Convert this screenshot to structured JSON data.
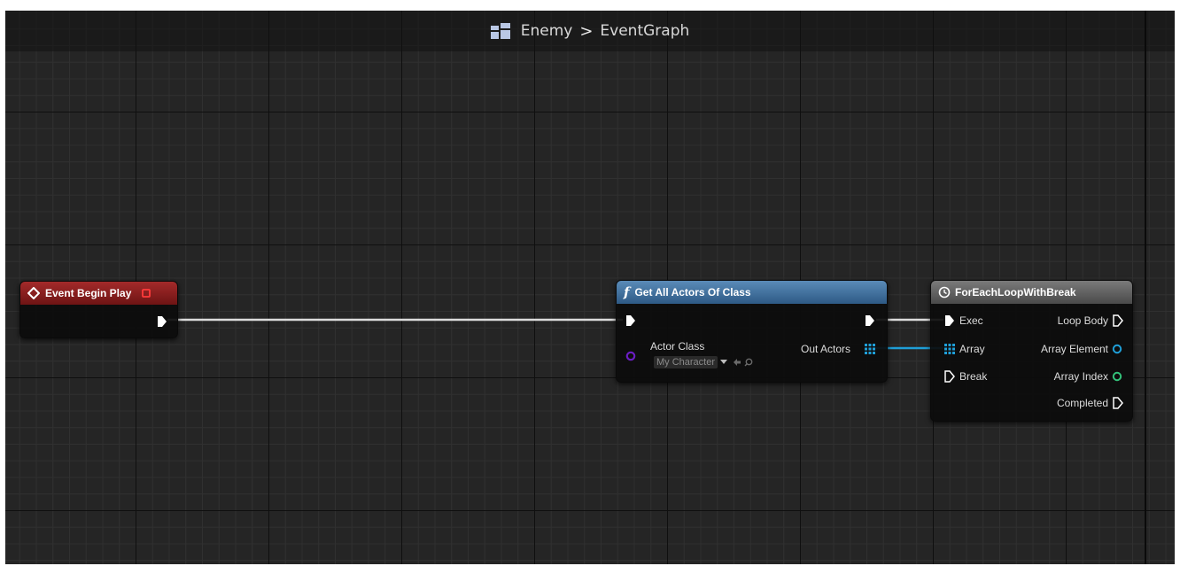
{
  "breadcrumb": {
    "icon": "blueprint-grid-icon",
    "asset": "Enemy",
    "separator": ">",
    "graph": "EventGraph"
  },
  "nodes": {
    "begin_play": {
      "title": "Event Begin Play",
      "header_color": "#8b1f1f"
    },
    "get_all_actors": {
      "title": "Get All Actors Of Class",
      "header_color": "#3f6f9e",
      "actor_class_label": "Actor Class",
      "actor_class_value": "My Character",
      "out_actors_label": "Out Actors"
    },
    "foreach": {
      "title": "ForEachLoopWithBreak",
      "header_color": "#5e5e5e",
      "inputs": [
        "Exec",
        "Array",
        "Break"
      ],
      "outputs": [
        "Loop Body",
        "Array Element",
        "Array Index",
        "Completed"
      ]
    }
  },
  "colors": {
    "exec_wire": "#e6e6e6",
    "array_wire": "#1f9fd8",
    "object_pin": "#1f9fd8",
    "int_pin": "#33c27a",
    "class_pin": "#6b1ec4"
  }
}
